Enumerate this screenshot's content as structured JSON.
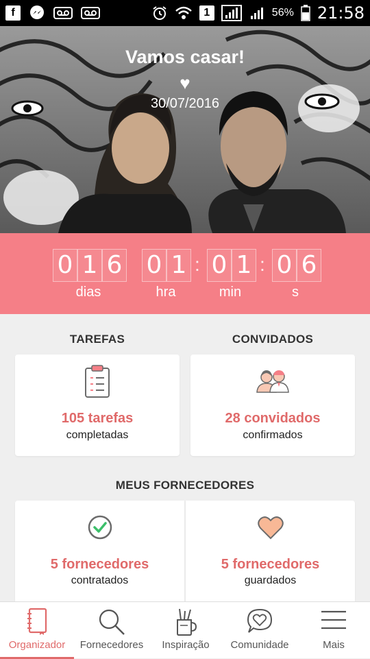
{
  "status_bar": {
    "battery_percent": "56%",
    "time": "21:58",
    "sim_slot": "1"
  },
  "hero": {
    "title": "Vamos casar!",
    "heart_icon": "heart-icon",
    "date": "30/07/2016"
  },
  "countdown": {
    "days": [
      "0",
      "1",
      "6"
    ],
    "hours": [
      "0",
      "1"
    ],
    "minutes": [
      "0",
      "1"
    ],
    "seconds": [
      "0",
      "6"
    ],
    "labels": {
      "days": "dias",
      "hours": "hra",
      "minutes": "min",
      "seconds": "s"
    }
  },
  "tasks": {
    "section_title": "TAREFAS",
    "count": "105 tarefas",
    "sub": "completadas",
    "icon": "clipboard-checklist-icon"
  },
  "guests": {
    "section_title": "CONVIDADOS",
    "count": "28 convidados",
    "sub": "confirmados",
    "icon": "guests-couple-icon"
  },
  "vendors": {
    "section_title": "MEUS FORNECEDORES",
    "hired": {
      "count": "5 fornecedores",
      "sub": "contratados",
      "icon": "check-circle-icon"
    },
    "saved": {
      "count": "5 fornecedores",
      "sub": "guardados",
      "icon": "heart-icon"
    }
  },
  "bottom_nav": {
    "items": [
      {
        "label": "Organizador",
        "icon": "notebook-icon",
        "active": true
      },
      {
        "label": "Fornecedores",
        "icon": "search-icon",
        "active": false
      },
      {
        "label": "Inspiração",
        "icon": "pencil-cup-icon",
        "active": false
      },
      {
        "label": "Comunidade",
        "icon": "chat-heart-icon",
        "active": false
      },
      {
        "label": "Mais",
        "icon": "menu-icon",
        "active": false
      }
    ]
  },
  "colors": {
    "accent": "#f57f87",
    "accent_text": "#e06a6a",
    "background": "#efefef"
  }
}
